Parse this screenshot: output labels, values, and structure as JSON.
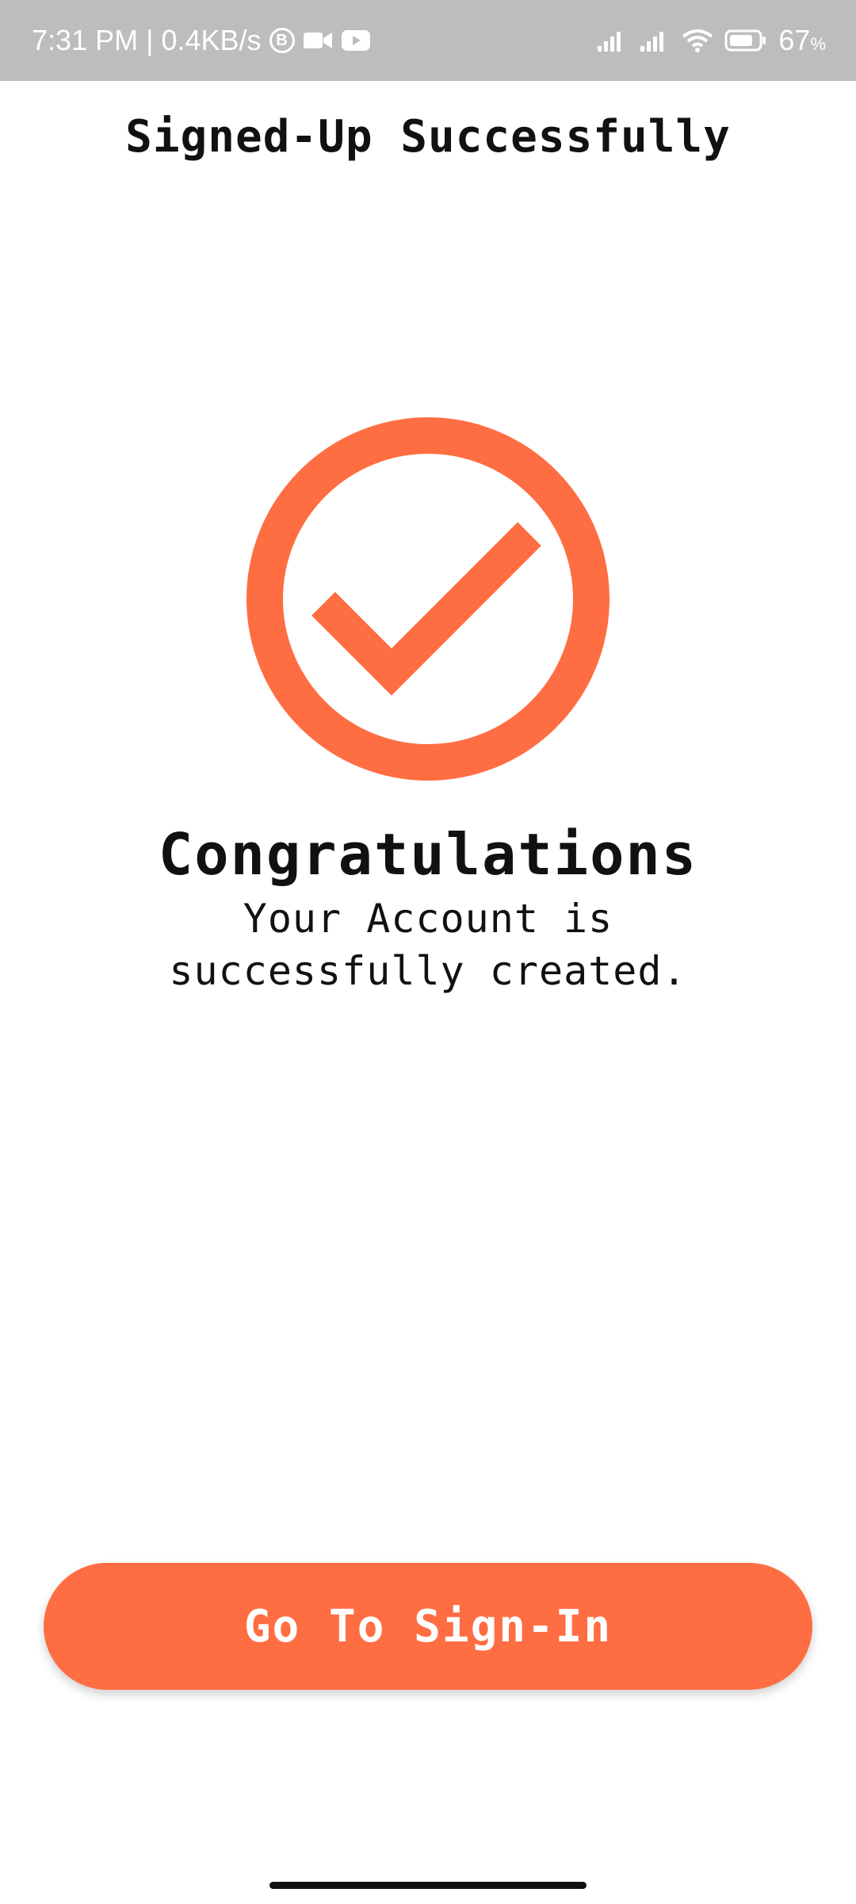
{
  "status_bar": {
    "time": "7:31 PM",
    "speed": "0.4KB/s",
    "badge": "B",
    "battery_percent": "67",
    "battery_unit": "%"
  },
  "header": {
    "title": "Signed-Up Successfully"
  },
  "main": {
    "heading": "Congratulations",
    "message": "Your Account is successfully created."
  },
  "actions": {
    "signin_label": "Go To Sign-In"
  },
  "colors": {
    "accent": "#ff6d42",
    "status_bar": "#bdbdbd",
    "text": "#111111",
    "background": "#ffffff"
  }
}
